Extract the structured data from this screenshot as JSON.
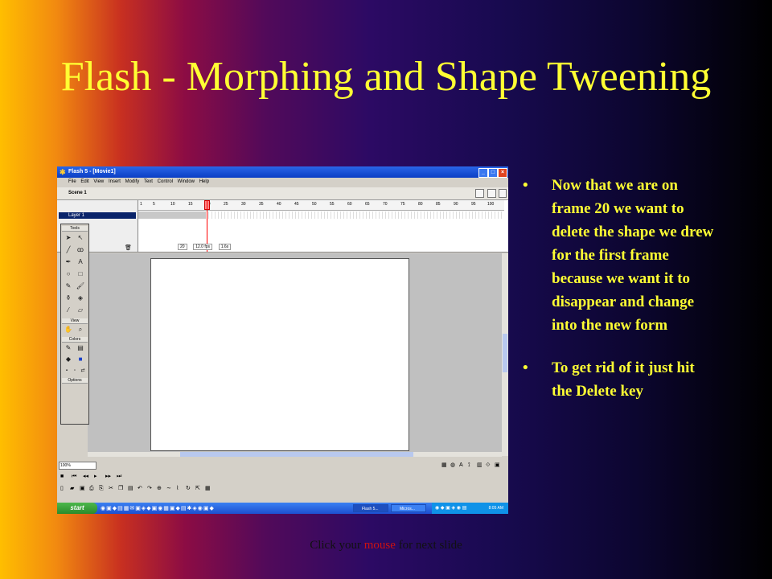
{
  "slide": {
    "title": "Flash - Morphing and Shape Tweening",
    "bullets": [
      "Now that we are on frame 20 we want to delete the shape we drew for the first frame because we want it to disappear and change into the new form",
      "To get rid of it just hit the Delete key"
    ],
    "footer": {
      "before": "Click your ",
      "highlight": "mouse",
      "after": " for next slide"
    }
  },
  "window": {
    "title": "Flash 5 - [Movie1]",
    "menu": [
      "File",
      "Edit",
      "View",
      "Insert",
      "Modify",
      "Text",
      "Control",
      "Window",
      "Help"
    ],
    "scene_label": "Scene 1",
    "timeline": {
      "layer_name": "Layer 1",
      "ruler": [
        "1",
        "5",
        "10",
        "15",
        "20",
        "25",
        "30",
        "35",
        "40",
        "45",
        "50",
        "55",
        "60",
        "65",
        "70",
        "75",
        "80",
        "85",
        "90",
        "95",
        "100"
      ],
      "current_frame": "20",
      "frame_rate": "12.0 fps",
      "elapsed": "1.6s"
    },
    "toolbox": {
      "title": "Tools",
      "view_label": "View",
      "colors_label": "Colors",
      "options_label": "Options"
    },
    "zoom": "100%"
  },
  "taskbar": {
    "start_label": "start",
    "tasks": [
      "Flash 5...",
      "Micros..."
    ],
    "clock": "8:05 AM"
  },
  "colors": {
    "title_yellow": "#ffff33",
    "footer_highlight": "#cc1111"
  }
}
